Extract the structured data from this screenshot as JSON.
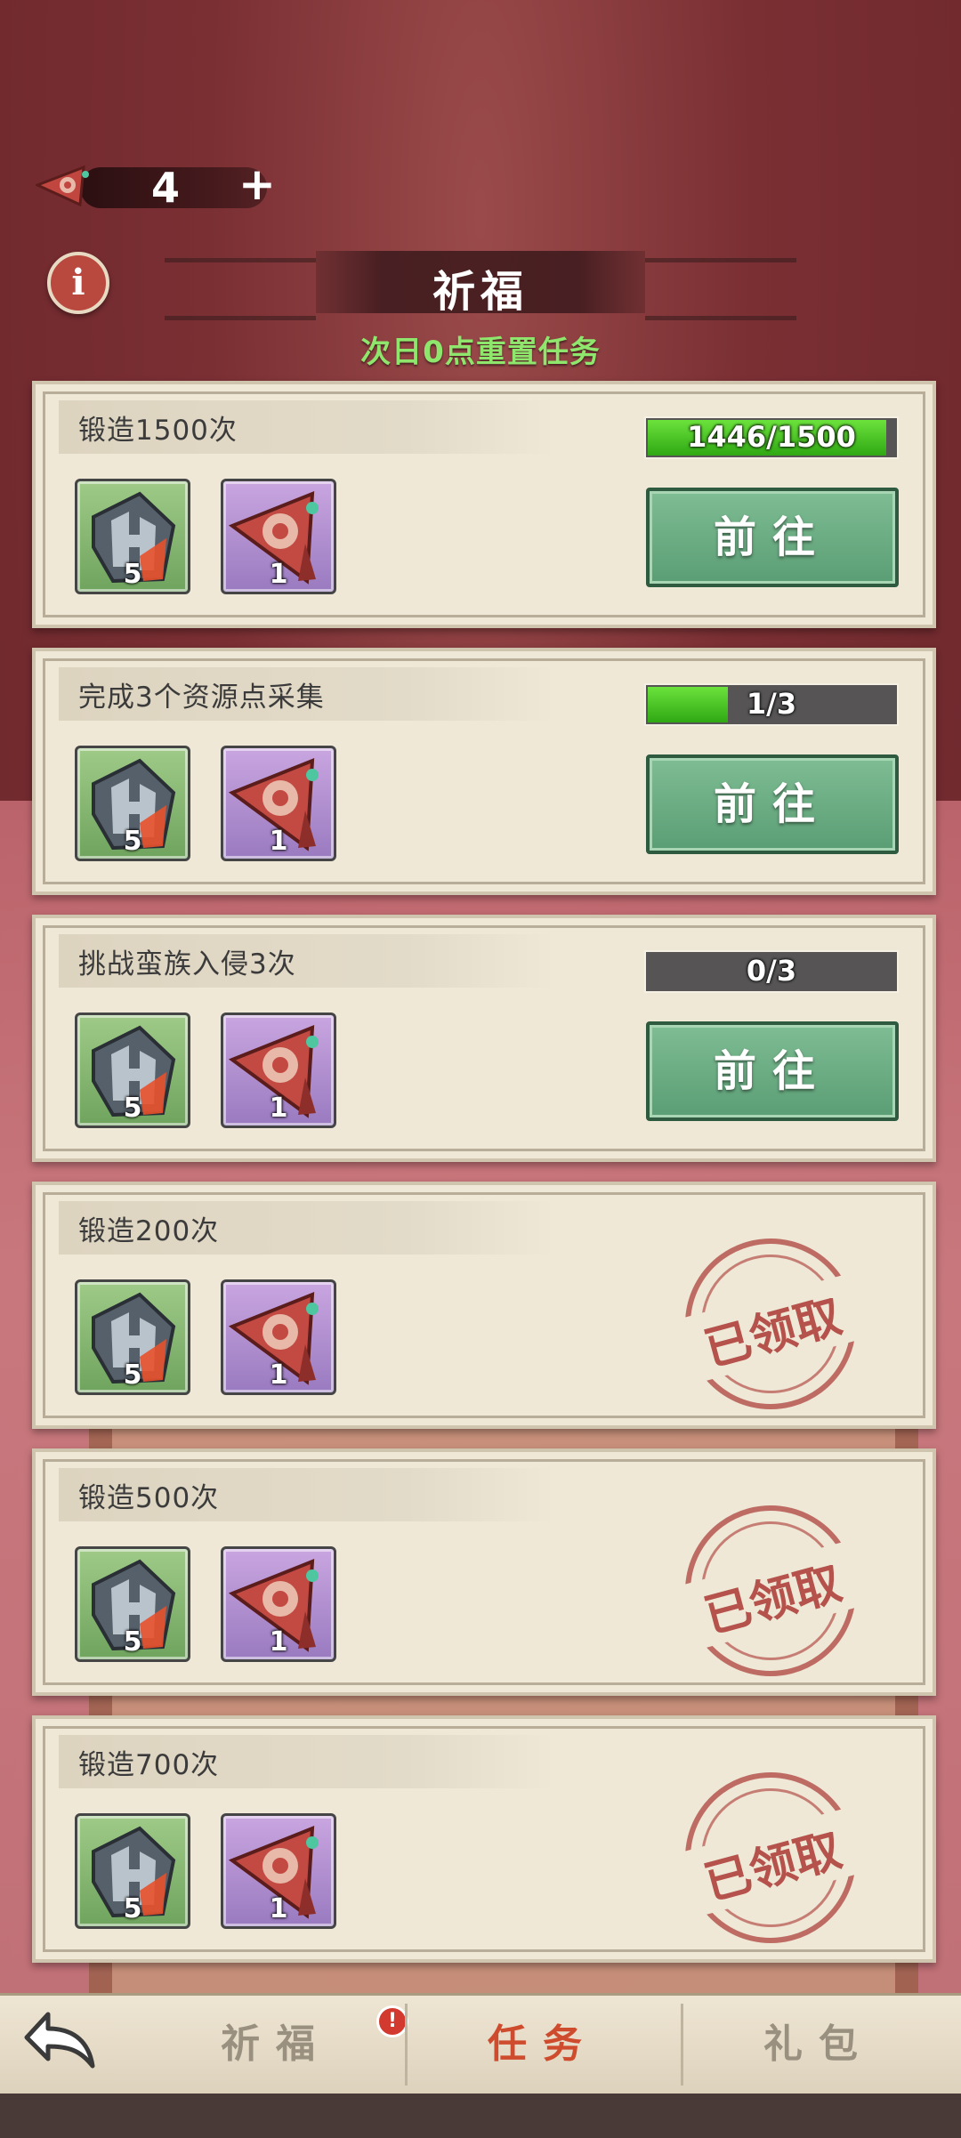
{
  "header": {
    "currency_count": "4",
    "currency_add": "+",
    "info_label": "i",
    "title": "祈福",
    "subtitle": "次日0点重置任务"
  },
  "tasks": [
    {
      "title": "锻造1500次",
      "progress_text": "1446/1500",
      "progress_fraction": 0.964,
      "action": "前往",
      "claimed": false,
      "rewards": [
        {
          "icon": "whetstone-icon",
          "qty": "5"
        },
        {
          "icon": "prayer-flag-icon",
          "qty": "1"
        }
      ]
    },
    {
      "title": "完成3个资源点采集",
      "progress_text": "1/3",
      "progress_fraction": 0.333,
      "action": "前往",
      "claimed": false,
      "rewards": [
        {
          "icon": "whetstone-icon",
          "qty": "5"
        },
        {
          "icon": "prayer-flag-icon",
          "qty": "1"
        }
      ]
    },
    {
      "title": "挑战蛮族入侵3次",
      "progress_text": "0/3",
      "progress_fraction": 0,
      "action": "前往",
      "claimed": false,
      "rewards": [
        {
          "icon": "whetstone-icon",
          "qty": "5"
        },
        {
          "icon": "prayer-flag-icon",
          "qty": "1"
        }
      ]
    },
    {
      "title": "锻造200次",
      "stamp": "已领取",
      "claimed": true,
      "rewards": [
        {
          "icon": "whetstone-icon",
          "qty": "5"
        },
        {
          "icon": "prayer-flag-icon",
          "qty": "1"
        }
      ]
    },
    {
      "title": "锻造500次",
      "stamp": "已领取",
      "claimed": true,
      "rewards": [
        {
          "icon": "whetstone-icon",
          "qty": "5"
        },
        {
          "icon": "prayer-flag-icon",
          "qty": "1"
        }
      ]
    },
    {
      "title": "锻造700次",
      "stamp": "已领取",
      "claimed": true,
      "rewards": [
        {
          "icon": "whetstone-icon",
          "qty": "5"
        },
        {
          "icon": "prayer-flag-icon",
          "qty": "1"
        }
      ]
    }
  ],
  "tabs": [
    {
      "label": "祈福",
      "active": false,
      "badge": "!"
    },
    {
      "label": "任务",
      "active": true
    },
    {
      "label": "礼包",
      "active": false
    }
  ],
  "colors": {
    "accent_green": "#8ee66d",
    "active_tab": "#cf4b2e",
    "button_green": "#6aa982"
  }
}
